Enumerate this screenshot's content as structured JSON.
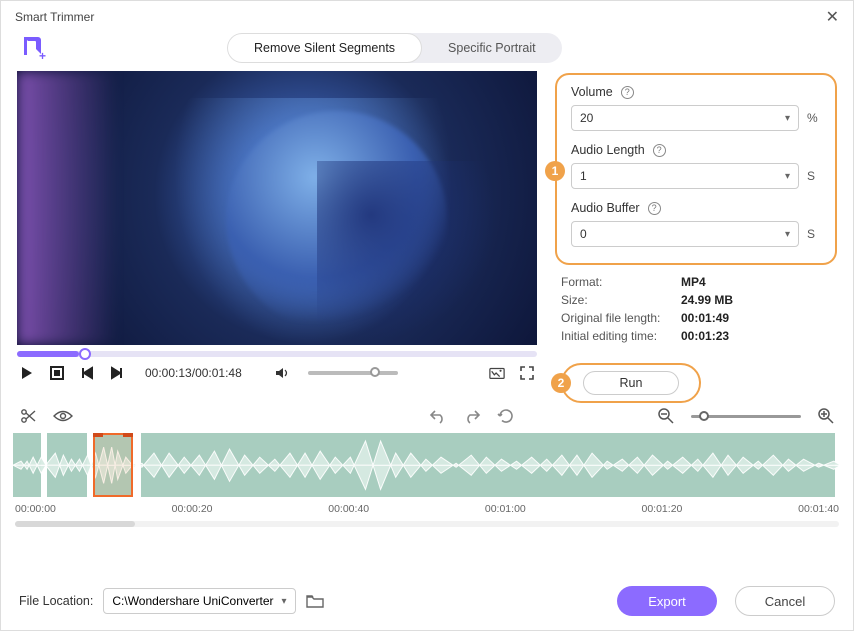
{
  "window": {
    "title": "Smart Trimmer"
  },
  "tabs": {
    "remove_silent": "Remove Silent Segments",
    "specific_portrait": "Specific Portrait"
  },
  "playback": {
    "current": "00:00:13",
    "total": "00:01:48"
  },
  "params": {
    "volume_label": "Volume",
    "volume_value": "20",
    "volume_unit": "%",
    "audio_length_label": "Audio Length",
    "audio_length_value": "1",
    "audio_length_unit": "S",
    "audio_buffer_label": "Audio Buffer",
    "audio_buffer_value": "0",
    "audio_buffer_unit": "S"
  },
  "info": {
    "format_k": "Format:",
    "format_v": "MP4",
    "size_k": "Size:",
    "size_v": "24.99 MB",
    "orig_len_k": "Original file length:",
    "orig_len_v": "00:01:49",
    "init_edit_k": "Initial editing time:",
    "init_edit_v": "00:01:23"
  },
  "badges": {
    "one": "1",
    "two": "2"
  },
  "run": {
    "label": "Run"
  },
  "timeline": {
    "ticks": [
      "00:00:00",
      "00:00:20",
      "00:00:40",
      "00:01:00",
      "00:01:20",
      "00:01:40"
    ]
  },
  "footer": {
    "location_label": "File Location:",
    "location_value": "C:\\Wondershare UniConverter",
    "export": "Export",
    "cancel": "Cancel"
  }
}
